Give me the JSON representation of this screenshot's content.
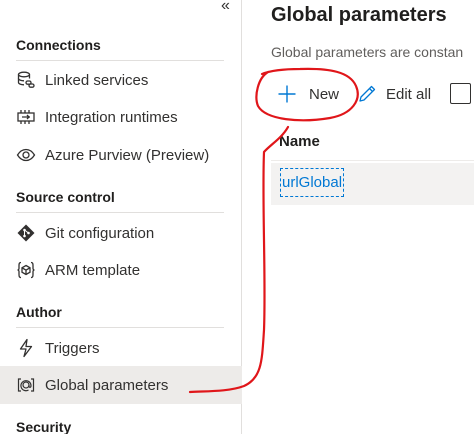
{
  "sidebar": {
    "collapse_glyph": "«",
    "sections": {
      "connections": "Connections",
      "source_control": "Source control",
      "author": "Author",
      "security": "Security"
    },
    "items": [
      {
        "label": "Linked services",
        "icon": "linked-services-icon"
      },
      {
        "label": "Integration runtimes",
        "icon": "integration-runtimes-icon"
      },
      {
        "label": "Azure Purview (Preview)",
        "icon": "eye-icon"
      },
      {
        "label": "Git configuration",
        "icon": "git-icon"
      },
      {
        "label": "ARM template",
        "icon": "arm-template-icon"
      },
      {
        "label": "Triggers",
        "icon": "lightning-icon"
      },
      {
        "label": "Global parameters",
        "icon": "global-parameters-icon",
        "selected": true
      }
    ]
  },
  "main": {
    "title": "Global parameters",
    "description": "Global parameters are constan",
    "toolbar": {
      "new_label": "New",
      "edit_all_label": "Edit all"
    },
    "table": {
      "column_header": "Name",
      "rows": [
        {
          "name": "urlGlobal"
        }
      ]
    }
  },
  "colors": {
    "accent": "#0078d4",
    "annotation": "#e0161a",
    "selected_bg": "#edebe9"
  }
}
